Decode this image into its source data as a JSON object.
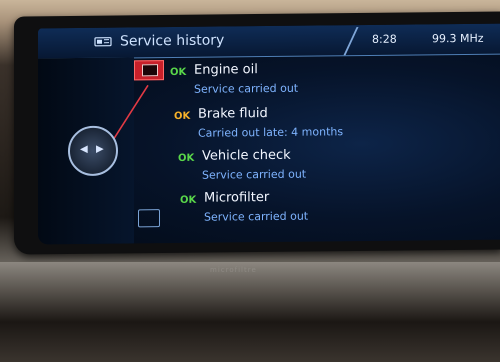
{
  "header": {
    "title": "Service history",
    "clock": "8:28",
    "radio": "99.3 MHz",
    "app_icon": "vehicle-service-icon"
  },
  "items": [
    {
      "status": "OK",
      "status_color": "#59d64a",
      "name": "Engine oil",
      "detail": "Service carried out",
      "icon": "engine-oil-icon"
    },
    {
      "status": "OK",
      "status_color": "#f6b12a",
      "name": "Brake fluid",
      "detail": "Carried out late: 4 months"
    },
    {
      "status": "OK",
      "status_color": "#59d64a",
      "name": "Vehicle check",
      "detail": "Service carried out"
    },
    {
      "status": "OK",
      "status_color": "#59d64a",
      "name": "Microfilter",
      "detail": "Service carried out"
    }
  ],
  "brand_mark": "microfiltre",
  "icons": {
    "controller": "idrive-controller-icon",
    "bottom": "manual-icon"
  }
}
